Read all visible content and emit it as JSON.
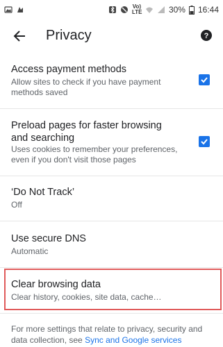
{
  "status_bar": {
    "battery_pct": "30%",
    "time": "16:44",
    "volte_label": "Vo) LTE"
  },
  "app_bar": {
    "title": "Privacy",
    "back_icon": "arrow-back-icon",
    "help_icon": "help-icon"
  },
  "items": [
    {
      "title": "Access payment methods",
      "subtitle": "Allow sites to check if you have payment methods saved",
      "checked": true
    },
    {
      "title": "Preload pages for faster browsing and searching",
      "subtitle": "Uses cookies to remember your preferences, even if you don't visit those pages",
      "checked": true
    },
    {
      "title": "‘Do Not Track’",
      "subtitle": "Off"
    },
    {
      "title": "Use secure DNS",
      "subtitle": "Automatic"
    },
    {
      "title": "Clear browsing data",
      "subtitle": "Clear history, cookies, site data, cache…"
    }
  ],
  "footer": {
    "text": "For more settings that relate to privacy, security and data collection, see ",
    "link": "Sync and Google services"
  },
  "colors": {
    "accent": "#1a73e8",
    "highlight_border": "#e05a5a"
  }
}
